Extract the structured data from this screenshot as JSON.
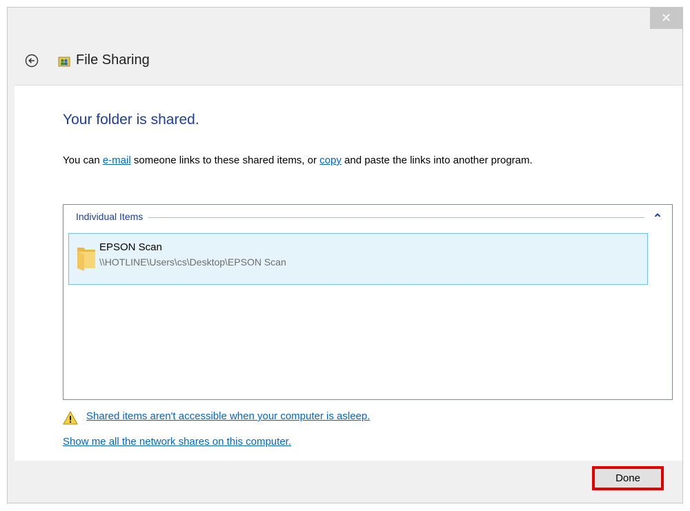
{
  "window": {
    "title": "File Sharing",
    "close_label": "✕"
  },
  "main": {
    "heading": "Your folder is shared.",
    "intro": {
      "before": "You can ",
      "email_link": "e-mail",
      "middle": " someone links to these shared items, or ",
      "copy_link": "copy",
      "after": " and paste the links into another program."
    },
    "items_group": {
      "header": "Individual Items",
      "items": [
        {
          "name": "EPSON Scan",
          "path": "\\\\HOTLINE\\Users\\cs\\Desktop\\EPSON Scan",
          "icon": "folder-icon"
        }
      ]
    },
    "warning_link": "Shared items aren't accessible when your computer is asleep.",
    "shares_link": "Show me all the network shares on this computer."
  },
  "footer": {
    "done_label": "Done"
  },
  "colors": {
    "heading": "#1e3f9b",
    "link": "#0066cc",
    "selection_bg": "#e5f3fb",
    "selection_border": "#70c0e7",
    "highlight": "#e50000"
  }
}
